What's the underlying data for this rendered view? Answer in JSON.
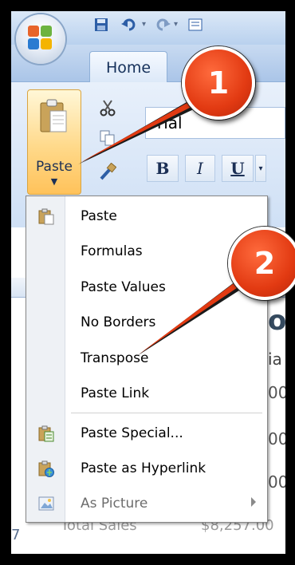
{
  "ribbon": {
    "tab_home": "Home",
    "paste_label": "Paste",
    "font_name": "rial"
  },
  "paste_menu": {
    "items": [
      {
        "label": "Paste",
        "icon": "paste-icon",
        "enabled": true
      },
      {
        "label": "Formulas",
        "icon": "",
        "enabled": true
      },
      {
        "label": "Paste Values",
        "icon": "",
        "enabled": true
      },
      {
        "label": "No Borders",
        "icon": "",
        "enabled": true
      },
      {
        "label": "Transpose",
        "icon": "",
        "enabled": true
      },
      {
        "label": "Paste Link",
        "icon": "",
        "enabled": true
      },
      {
        "label": "Paste Special...",
        "icon": "paste-special-icon",
        "enabled": true
      },
      {
        "label": "Paste as Hyperlink",
        "icon": "paste-hyperlink-icon",
        "enabled": true
      },
      {
        "label": "As Picture",
        "icon": "picture-icon",
        "enabled": false
      }
    ]
  },
  "sheet": {
    "row7_label": "Total Sales",
    "row7_value": "$8,257.00",
    "row7_number": "7",
    "header_fragment": "on",
    "subheader_fragment": "ia",
    "cell_fragment_1": "00",
    "cell_fragment_2": "00",
    "cell_fragment_3": "00"
  },
  "callouts": {
    "step1": "1",
    "step2": "2"
  },
  "colors": {
    "callout_red": "#e23a12",
    "ribbon_blue": "#cfe0f5",
    "paste_orange": "#ffd98a"
  }
}
